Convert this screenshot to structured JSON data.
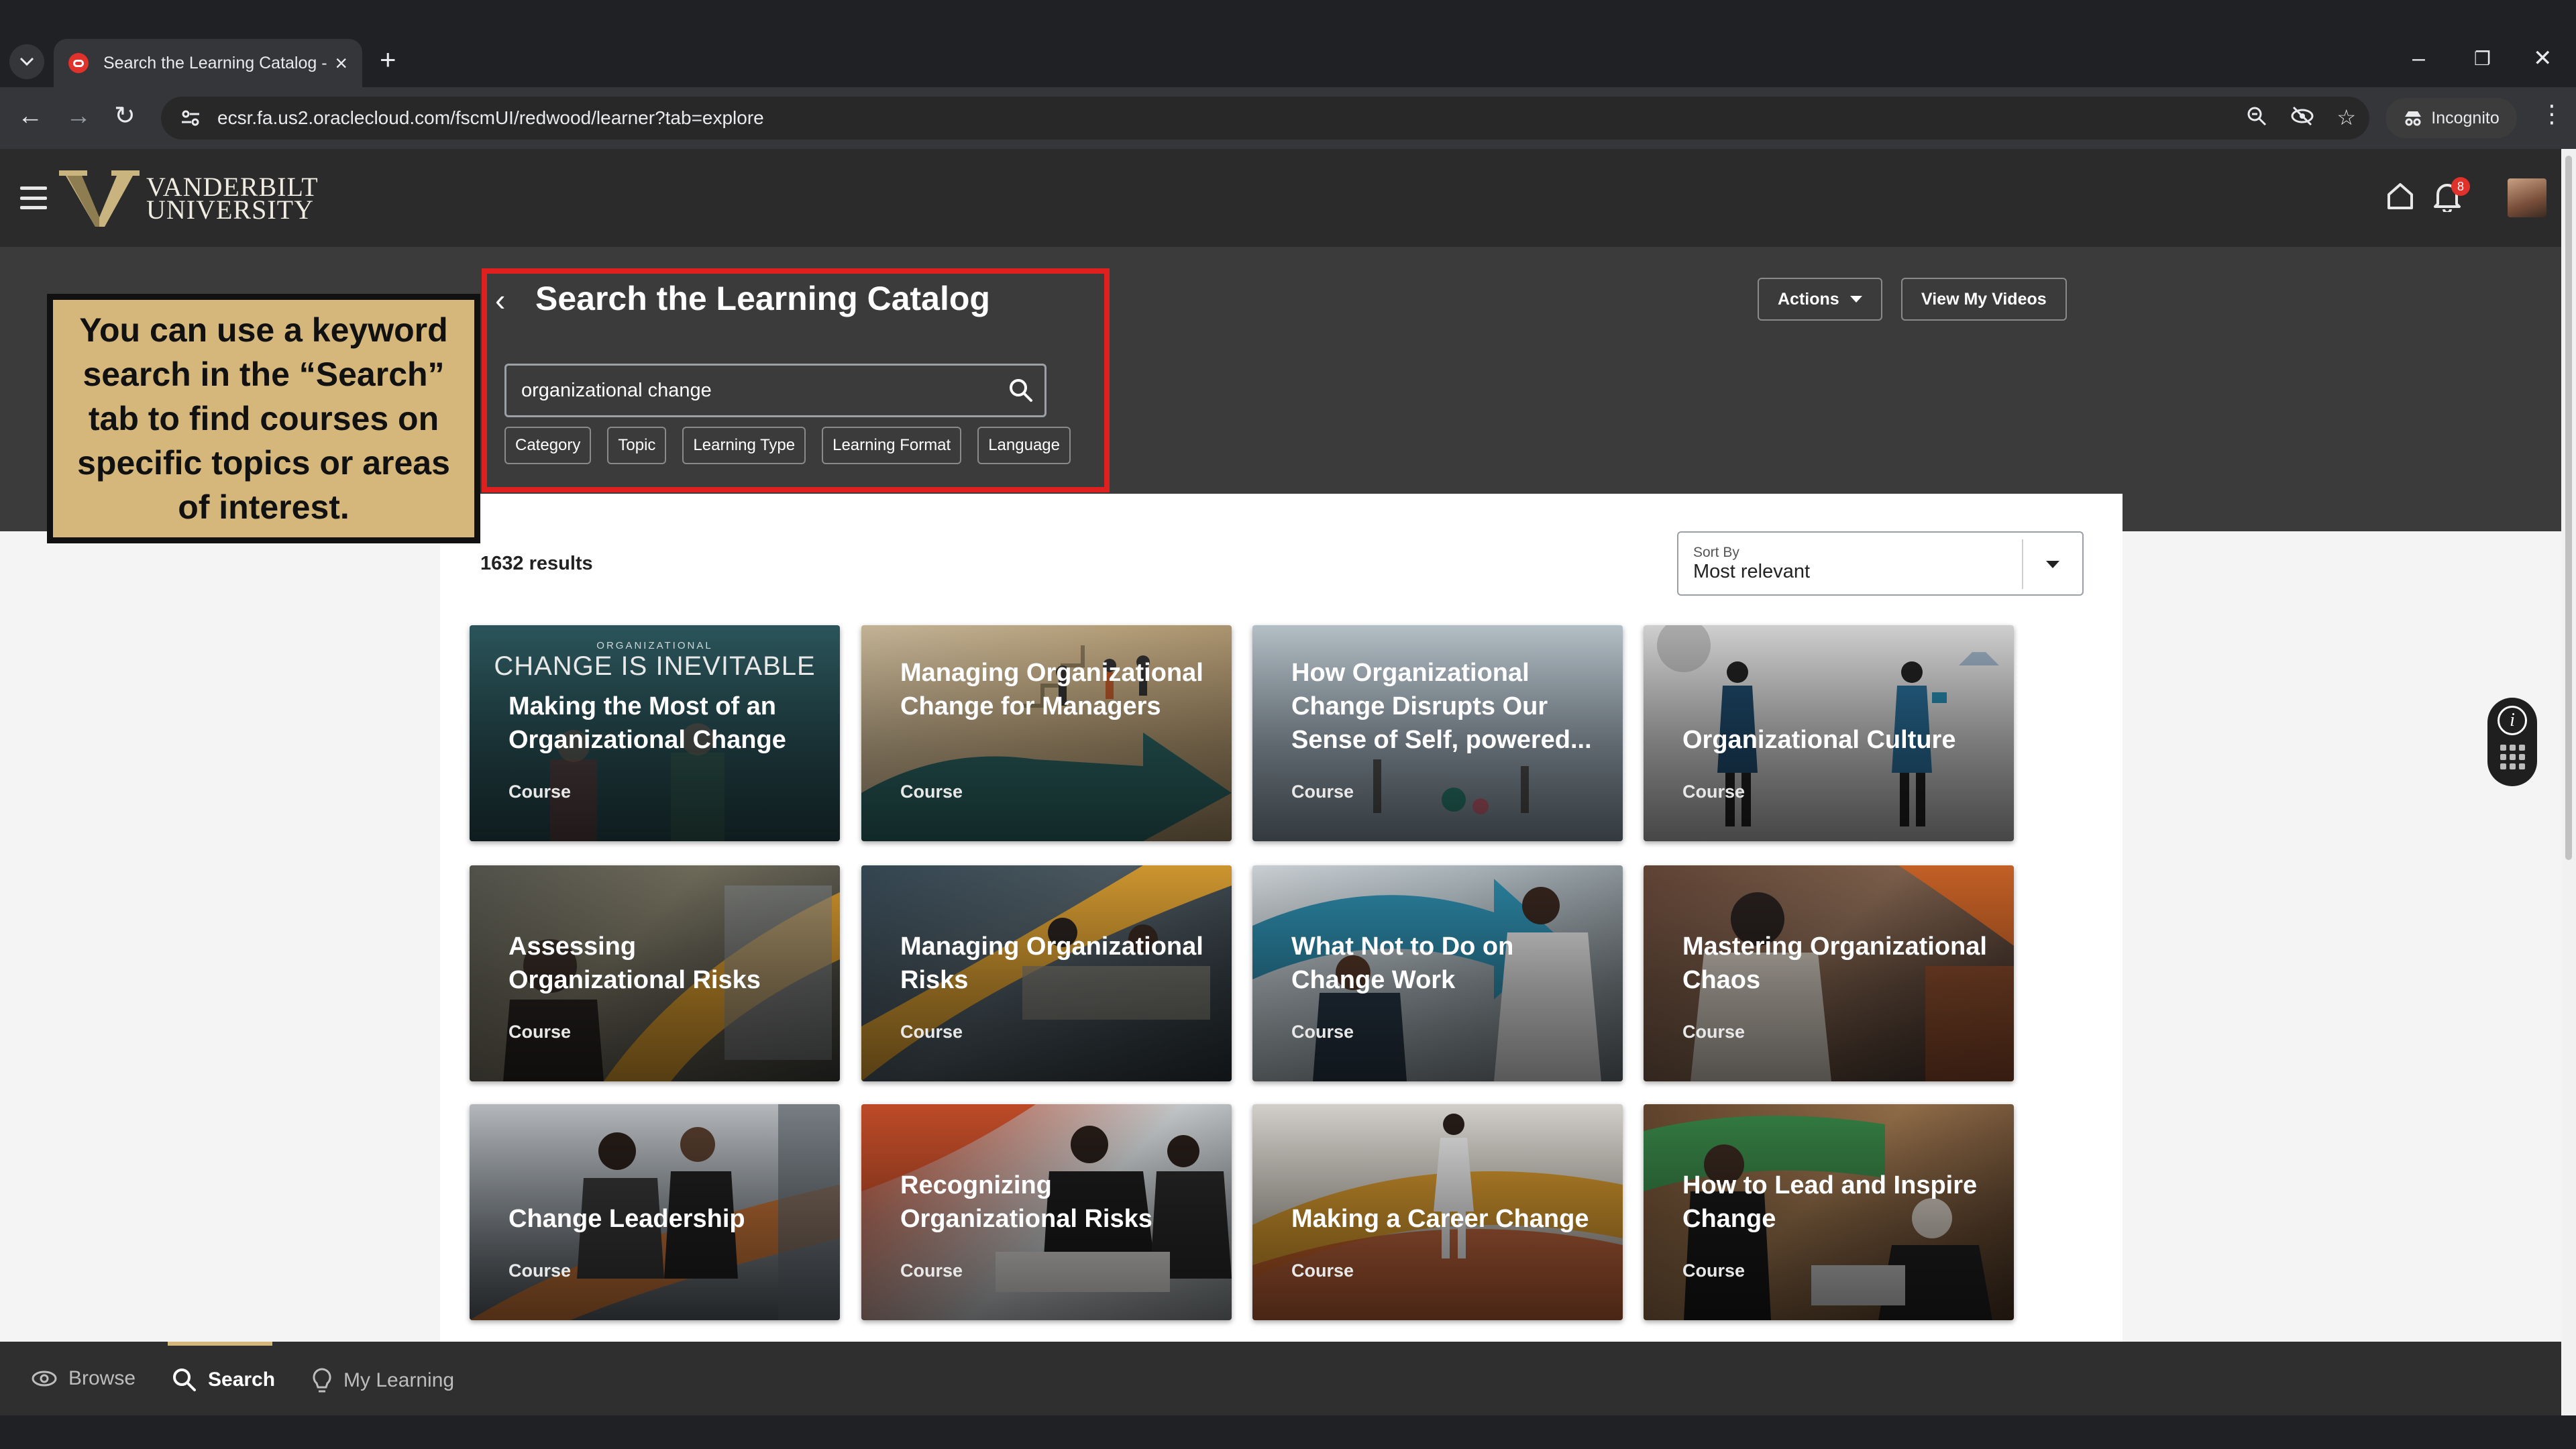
{
  "browser": {
    "tab_title": "Search the Learning Catalog - O",
    "url": "ecsr.fa.us2.oraclecloud.com/fscmUI/redwood/learner?tab=explore",
    "incognito_label": "Incognito"
  },
  "header": {
    "logo_line1": "VANDERBILT",
    "logo_line2": "UNIVERSITY",
    "notification_count": "8"
  },
  "callout": {
    "text": "You can use a keyword search in the “Search” tab to find courses on specific topics or areas of interest."
  },
  "search": {
    "title": "Search the Learning Catalog",
    "query": "organizational change",
    "filters": [
      "Category",
      "Topic",
      "Learning Type",
      "Learning Format",
      "Language"
    ]
  },
  "actions": {
    "actions_label": "Actions",
    "view_videos_label": "View My Videos"
  },
  "results": {
    "count_text": "1632 results",
    "sort_label": "Sort By",
    "sort_value": "Most relevant"
  },
  "cards": [
    {
      "title": "Making the Most of an Organizational Change",
      "type": "Course",
      "banner_small": "ORGANIZATIONAL",
      "banner": "CHANGE IS INEVITABLE"
    },
    {
      "title": "Managing Organizational Change for Managers",
      "type": "Course"
    },
    {
      "title": "How Organizational Change Disrupts Our Sense of Self, powered...",
      "type": "Course"
    },
    {
      "title": "Organizational Culture",
      "type": "Course"
    },
    {
      "title": "Assessing Organizational Risks",
      "type": "Course"
    },
    {
      "title": "Managing Organizational Risks",
      "type": "Course"
    },
    {
      "title": "What Not to Do on Change Work",
      "type": "Course"
    },
    {
      "title": "Mastering Organizational Chaos",
      "type": "Course"
    },
    {
      "title": "Change Leadership",
      "type": "Course"
    },
    {
      "title": "Recognizing Organizational Risks",
      "type": "Course"
    },
    {
      "title": "Making a Career Change",
      "type": "Course"
    },
    {
      "title": "How to Lead and Inspire Change",
      "type": "Course"
    }
  ],
  "bottom_nav": {
    "browse": "Browse",
    "search": "Search",
    "my_learning": "My Learning"
  },
  "colors": {
    "accent_gold": "#d5b77b",
    "highlight_red": "#e0201f",
    "header_dark": "#2b2b2b"
  }
}
